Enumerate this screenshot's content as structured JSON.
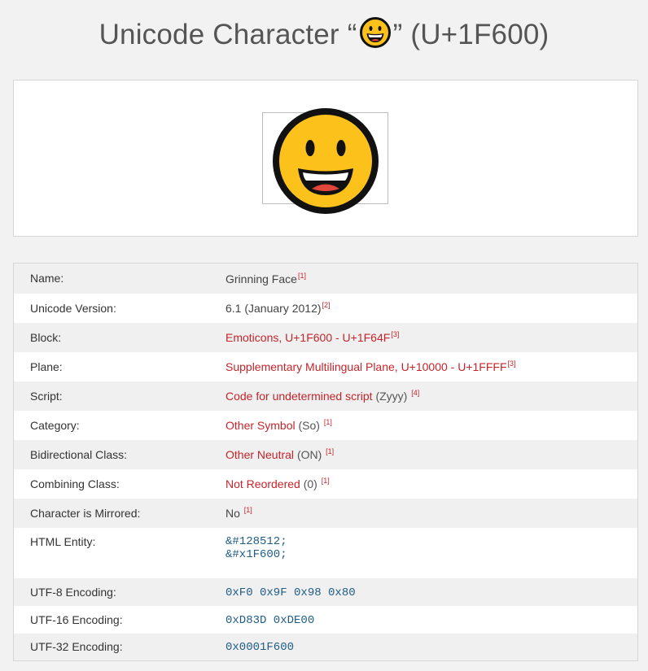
{
  "title": {
    "prefix": "Unicode Character “",
    "suffix": "” (U+1F600)"
  },
  "preview": {
    "emoji_icon": "grinning-face-icon"
  },
  "rows": [
    {
      "key": "Name:",
      "value": "Grinning Face",
      "ref": "[1]"
    },
    {
      "key": "Unicode Version:",
      "value": "6.1 (January 2012)",
      "ref": "[2]"
    },
    {
      "key": "Block:",
      "value": "Emoticons, U+1F600 - U+1F64F",
      "ref": "[3]"
    },
    {
      "key": "Plane:",
      "value": "Supplementary Multilingual Plane, U+10000 - U+1FFFF",
      "ref": "[3]"
    },
    {
      "key": "Script:",
      "link": "Code for undetermined script",
      "extra": "(Zyyy)",
      "ref": "[4]"
    },
    {
      "key": "Category:",
      "link": "Other Symbol",
      "extra": "(So)",
      "ref": "[1]"
    },
    {
      "key": "Bidirectional Class:",
      "link": "Other Neutral",
      "extra": "(ON)",
      "ref": "[1]"
    },
    {
      "key": "Combining Class:",
      "link": "Not Reordered",
      "extra": "(0)",
      "ref": "[1]"
    },
    {
      "key": "Character is Mirrored:",
      "value": "No",
      "ref": "[1]"
    },
    {
      "key": "HTML Entity:",
      "entities": [
        "&#128512;",
        "&#x1F600;"
      ]
    },
    {
      "key": "UTF-8 Encoding:",
      "value": "0xF0 0x9F 0x98 0x80"
    },
    {
      "key": "UTF-16 Encoding:",
      "value": "0xD83D 0xDE00"
    },
    {
      "key": "UTF-32 Encoding:",
      "value": "0x0001F600"
    }
  ],
  "colors": {
    "link": "#c4252b",
    "code": "#1f5c86",
    "face": "#fcc21b"
  }
}
